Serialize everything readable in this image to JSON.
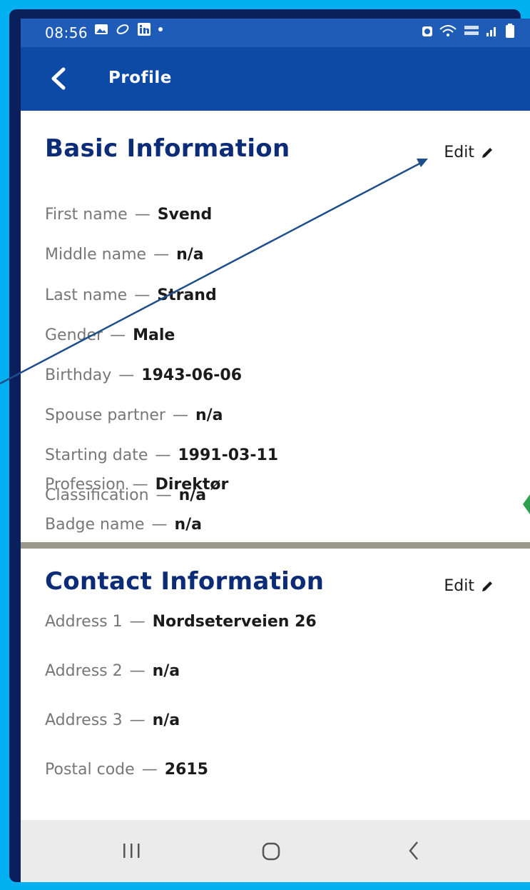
{
  "status_bar": {
    "time": "08:56",
    "icons": [
      "gallery-icon",
      "link-icon",
      "linkedin-icon",
      "dot-icon"
    ],
    "right_icons": [
      "alarm-icon",
      "wifi-icon",
      "volte-icon",
      "signal-icon",
      "battery-icon"
    ]
  },
  "app_bar": {
    "title": "Profile",
    "back_icon": "chevron-left-icon",
    "color": "#0d4aa6"
  },
  "basic_info": {
    "title": "Basic Information",
    "edit_label": "Edit",
    "fields": [
      {
        "label": "First name",
        "sep": "—",
        "value": "Svend"
      },
      {
        "label": "Middle name",
        "sep": "—",
        "value": "n/a"
      },
      {
        "label": "Last name",
        "sep": "—",
        "value": "Strand"
      },
      {
        "label": "Gender",
        "sep": "—",
        "value": "Male"
      },
      {
        "label": "Birthday",
        "sep": "—",
        "value": "1943-06-06"
      },
      {
        "label": "Spouse partner",
        "sep": "—",
        "value": "n/a"
      },
      {
        "label": "Starting date",
        "sep": "—",
        "value": "1991-03-11"
      },
      {
        "label": "Classification",
        "sep": "—",
        "value": "n/a"
      },
      {
        "label": "Profession",
        "sep": "—",
        "value": "Direktør"
      },
      {
        "label": "Badge name",
        "sep": "—",
        "value": "n/a"
      }
    ]
  },
  "contact_info": {
    "title": "Contact Information",
    "edit_label": "Edit",
    "fields": [
      {
        "label": "Address 1",
        "sep": "—",
        "value": "Nordseterveien 26"
      },
      {
        "label": "Address 2",
        "sep": "—",
        "value": "n/a"
      },
      {
        "label": "Address 3",
        "sep": "—",
        "value": "n/a"
      },
      {
        "label": "Postal code",
        "sep": "—",
        "value": "2615"
      }
    ]
  },
  "nav_bar": {
    "icons": [
      "recent-apps-icon",
      "home-icon",
      "back-icon"
    ]
  },
  "colors": {
    "background": "#00b0f0",
    "frame": "#0a1f5c",
    "title": "#0d2c78",
    "annotation_arrow": "#1f4e8c",
    "annotation_marker": "#2e9e4f"
  }
}
